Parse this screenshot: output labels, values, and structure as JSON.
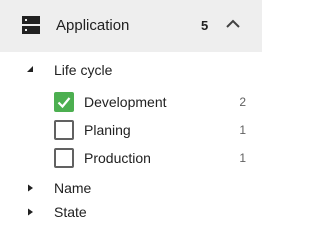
{
  "header": {
    "title": "Application",
    "count": "5",
    "icon": "storage-icon",
    "chevron_icon": "chevron-up-icon"
  },
  "groups": [
    {
      "label": "Life cycle",
      "expanded": true,
      "options": [
        {
          "label": "Development",
          "count": "2",
          "checked": true
        },
        {
          "label": "Planing",
          "count": "1",
          "checked": false
        },
        {
          "label": "Production",
          "count": "1",
          "checked": false
        }
      ]
    },
    {
      "label": "Name",
      "expanded": false
    },
    {
      "label": "State",
      "expanded": false
    }
  ],
  "colors": {
    "header_bg": "#eeeeee",
    "checkbox_checked": "#4caf50",
    "checkbox_border": "#616161"
  }
}
